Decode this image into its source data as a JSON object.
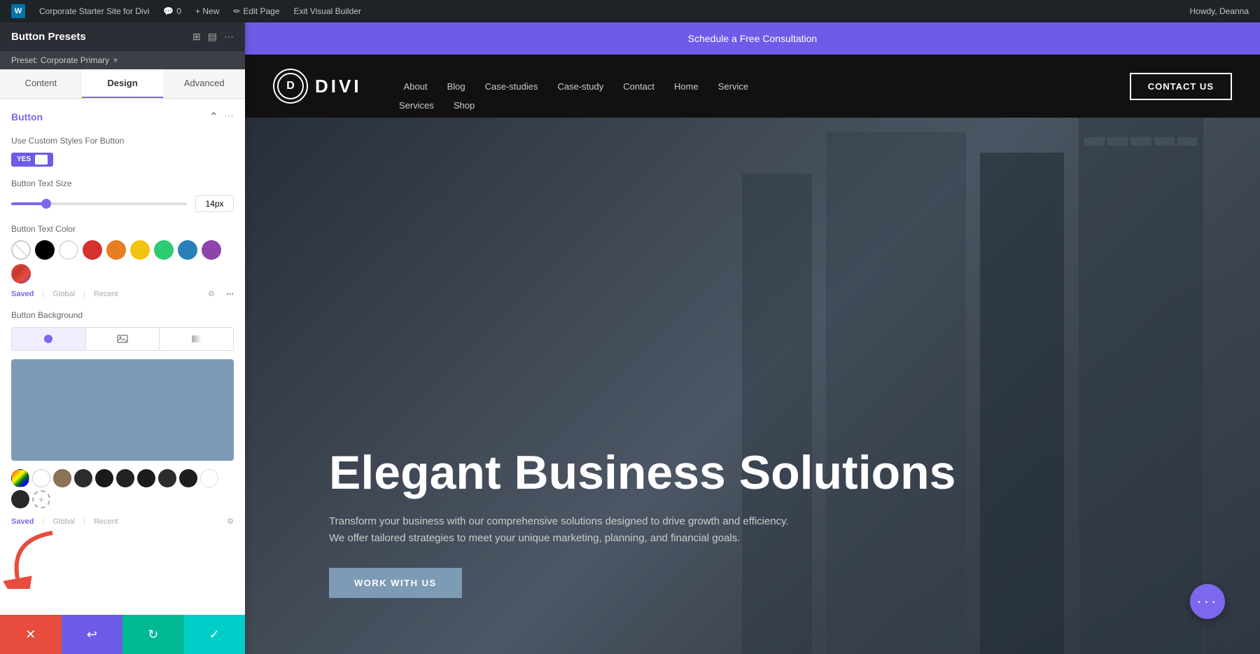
{
  "admin_bar": {
    "wp_icon": "W",
    "site_name": "Corporate Starter Site for Divi",
    "comments_label": "0",
    "new_label": "+ New",
    "edit_page_label": "Edit Page",
    "exit_builder_label": "Exit Visual Builder",
    "howdy_label": "Howdy, Deanna"
  },
  "panel": {
    "title": "Button Presets",
    "subtitle_label": "Preset:",
    "subtitle_value": "Corporate Primary",
    "tabs": [
      {
        "label": "Content",
        "active": false
      },
      {
        "label": "Design",
        "active": true
      },
      {
        "label": "Advanced",
        "active": false
      }
    ],
    "section_title": "Button",
    "use_custom_label": "Use Custom Styles For Button",
    "toggle_yes": "YES",
    "button_text_size_label": "Button Text Size",
    "slider_value": "14px",
    "button_text_color_label": "Button Text Color",
    "color_swatches": [
      {
        "color": "transparent",
        "label": "transparent"
      },
      {
        "color": "#000000",
        "label": "black"
      },
      {
        "color": "#ffffff",
        "label": "white"
      },
      {
        "color": "#d63031",
        "label": "red"
      },
      {
        "color": "#e67e22",
        "label": "orange"
      },
      {
        "color": "#f1c40f",
        "label": "yellow"
      },
      {
        "color": "#2ecc71",
        "label": "green"
      },
      {
        "color": "#2980b9",
        "label": "blue"
      },
      {
        "color": "#8e44ad",
        "label": "purple"
      },
      {
        "color": "#c0392b",
        "label": "dark-red"
      }
    ],
    "color_tabs": [
      "Saved",
      "Global",
      "Recent"
    ],
    "active_color_tab": "Saved",
    "button_background_label": "Button Background",
    "bg_tabs": [
      {
        "icon": "color",
        "label": "color"
      },
      {
        "icon": "image",
        "label": "image"
      },
      {
        "icon": "gradient",
        "label": "gradient"
      }
    ],
    "bg_color": "#7e9bb5",
    "bottom_swatches": [
      {
        "color": "transparent"
      },
      {
        "color": "#8b7355"
      },
      {
        "color": "#8b7355"
      },
      {
        "color": "#2c2c2c"
      },
      {
        "color": "#1a1a1a"
      },
      {
        "color": "#222222"
      },
      {
        "color": "#2c2c2c"
      },
      {
        "color": "#1c1c1c"
      },
      {
        "color": "#2a2a2a"
      },
      {
        "color": "transparent2"
      },
      {
        "color": "#2d2d2d"
      }
    ],
    "footer_buttons": [
      {
        "action": "cancel",
        "icon": "✕"
      },
      {
        "action": "undo",
        "icon": "↩"
      },
      {
        "action": "redo",
        "icon": "↻"
      },
      {
        "action": "save",
        "icon": "✓"
      }
    ]
  },
  "topbar": {
    "text": "Schedule a Free Consultation"
  },
  "nav": {
    "logo_letter": "D",
    "logo_text": "DIVI",
    "links": [
      "About",
      "Blog",
      "Case-studies",
      "Case-study",
      "Contact",
      "Home",
      "Service"
    ],
    "second_row_links": [
      "Services",
      "Shop"
    ],
    "contact_btn": "CONTACT US"
  },
  "hero": {
    "title": "Elegant Business Solutions",
    "subtitle": "Transform your business with our comprehensive solutions designed to drive growth and efficiency. We offer tailored strategies to meet your unique marketing, planning, and financial goals.",
    "cta_button": "WORK WITH US"
  },
  "colors": {
    "accent": "#7b68ee",
    "bg_preview": "#7e9bb5",
    "footer_cancel": "#e74c3c",
    "footer_undo": "#6c5ce7",
    "footer_redo": "#00b894",
    "footer_save": "#00cec9"
  }
}
